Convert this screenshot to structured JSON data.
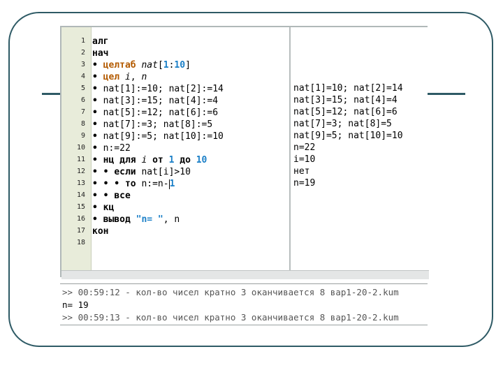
{
  "line_numbers": [
    "1",
    "2",
    "3",
    "4",
    "5",
    "6",
    "7",
    "8",
    "9",
    "10",
    "11",
    "12",
    "13",
    "14",
    "15",
    "16",
    "17",
    "18"
  ],
  "code": {
    "l1": {
      "kw": "алг"
    },
    "l2": {
      "kw": "нач"
    },
    "l3": {
      "dot": "•",
      "kw": "целтаб",
      "var": "nat",
      "b1": "[",
      "n1": "1",
      "c": ":",
      "n2": "10",
      "b2": "]"
    },
    "l4": {
      "dot": "•",
      "kw": "цел",
      "v1": "i",
      "sep": ",",
      "v2": "n"
    },
    "l5": {
      "dot": "•",
      "text": "nat[1]:=10; nat[2]:=14"
    },
    "l6": {
      "dot": "•",
      "text": "nat[3]:=15; nat[4]:=4"
    },
    "l7": {
      "dot": "•",
      "text": "nat[5]:=12; nat[6]:=6"
    },
    "l8": {
      "dot": "•",
      "text": "nat[7]:=3; nat[8]:=5"
    },
    "l9": {
      "dot": "•",
      "text": "nat[9]:=5; nat[10]:=10"
    },
    "l10": {
      "dot": "•",
      "text": "n:=22"
    },
    "l11": {
      "dot": "•",
      "kw1": "нц для",
      "v": "i",
      "kw2": "от",
      "n1": "1",
      "kw3": "до",
      "n2": "10"
    },
    "l12": {
      "dots": "• •",
      "kw": "если",
      "cond": "nat[i]>10"
    },
    "l13": {
      "dots": "• • •",
      "kw": "то",
      "assign": "n:=n-",
      "n": "1"
    },
    "l14": {
      "dots": "• •",
      "kw": "все"
    },
    "l15": {
      "dot": "•",
      "kw": "кц"
    },
    "l16": {
      "dot": "•",
      "kw": "вывод",
      "str": "\"n= \"",
      "rest": ", n"
    },
    "l17": {
      "kw": "кон"
    }
  },
  "output_panel": [
    "nat[1]=10; nat[2]=14",
    "nat[3]=15; nat[4]=4",
    "nat[5]=12; nat[6]=6",
    "nat[7]=3; nat[8]=5",
    "nat[9]=5; nat[10]=10",
    "n=22",
    "i=10",
    "нет",
    "n=19"
  ],
  "console": [
    ">> 00:59:12 - кол-во чисел кратно 3 оканчивается 8 вар1-20-2.kum",
    "n= 19",
    ">> 00:59:13 - кол-во чисел кратно 3 оканчивается 8 вар1-20-2.kum"
  ],
  "colors": {
    "frame": "#2e5a65",
    "gutter": "#e8ecda",
    "keyword_type": "#b35a00",
    "number": "#1a7fc7"
  }
}
